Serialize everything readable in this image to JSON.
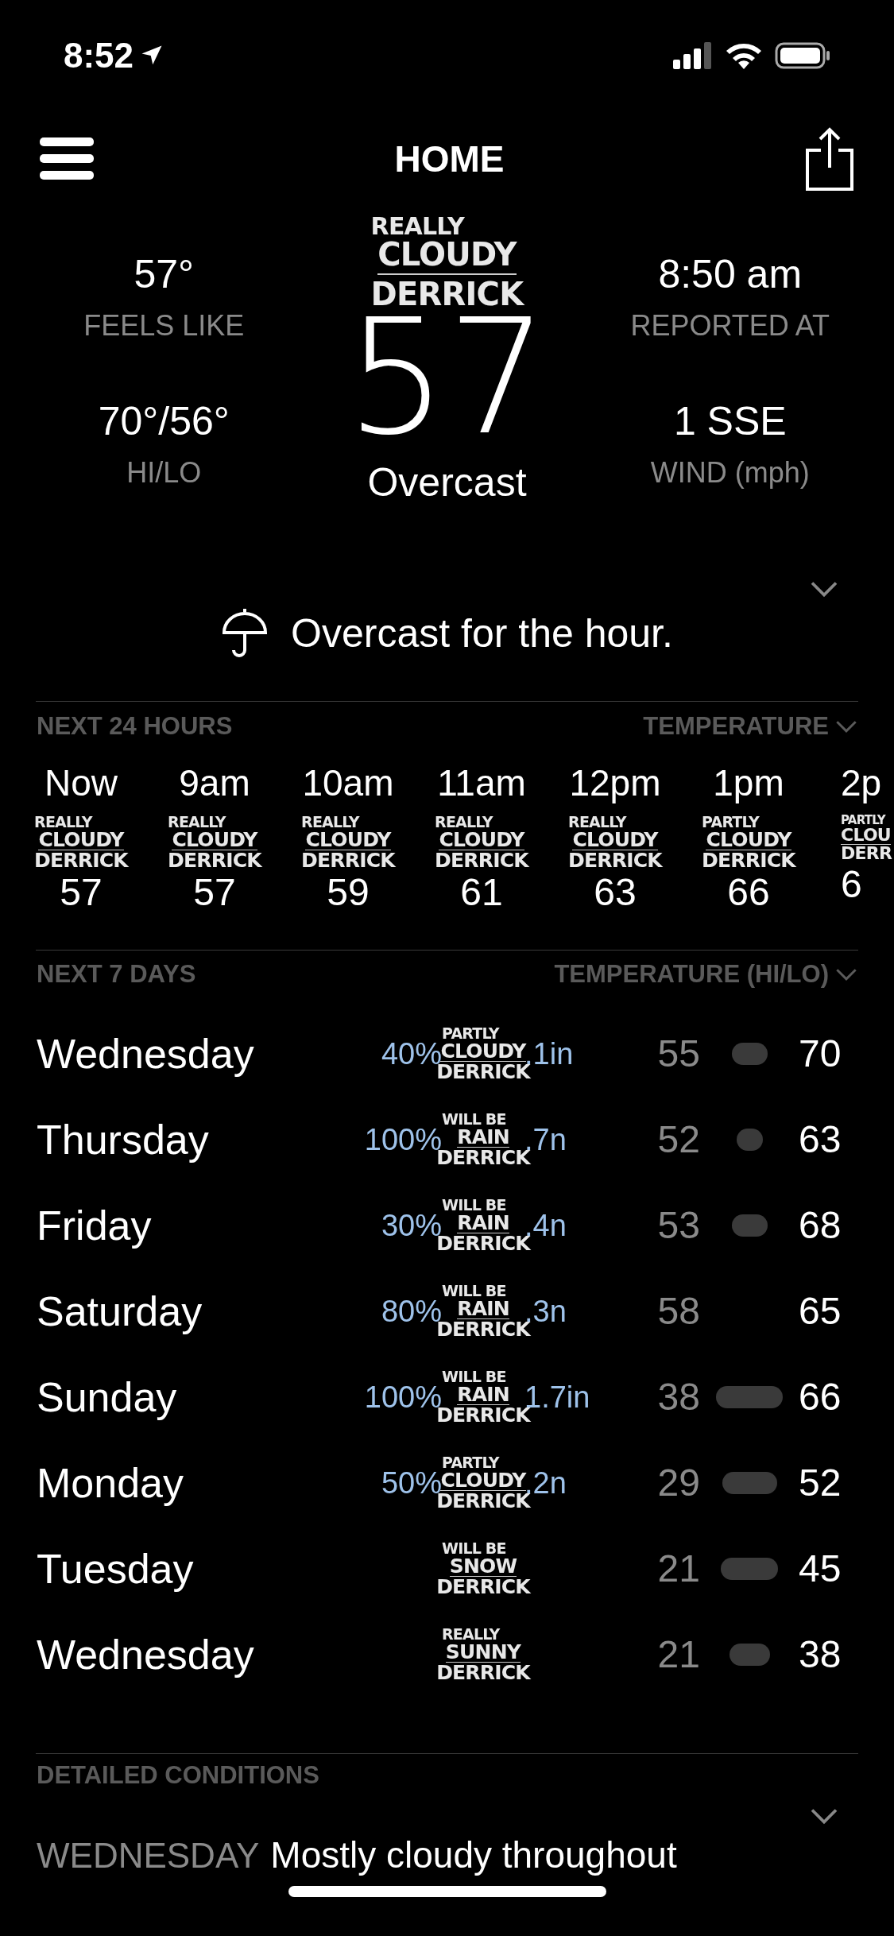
{
  "status_bar": {
    "time": "8:52"
  },
  "header": {
    "title": "HOME"
  },
  "current": {
    "logo": [
      "REALLY",
      "CLOUDY",
      "DERRICK"
    ],
    "temperature": "57",
    "condition": "Overcast",
    "metrics": [
      {
        "value": "57°",
        "label": "FEELS LIKE"
      },
      {
        "value": "8:50 am",
        "label": "REPORTED AT"
      },
      {
        "value": "70°/56°",
        "label": "HI/LO"
      },
      {
        "value": "1 SSE",
        "label": "WIND (mph)"
      }
    ]
  },
  "summary": {
    "text": "Overcast for the hour."
  },
  "hourly": {
    "title": "NEXT 24 HOURS",
    "selector": "TEMPERATURE",
    "hours": [
      {
        "time": "Now",
        "logo": [
          "REALLY",
          "CLOUDY",
          "DERRICK"
        ],
        "temp": "57"
      },
      {
        "time": "9am",
        "logo": [
          "REALLY",
          "CLOUDY",
          "DERRICK"
        ],
        "temp": "57"
      },
      {
        "time": "10am",
        "logo": [
          "REALLY",
          "CLOUDY",
          "DERRICK"
        ],
        "temp": "59"
      },
      {
        "time": "11am",
        "logo": [
          "REALLY",
          "CLOUDY",
          "DERRICK"
        ],
        "temp": "61"
      },
      {
        "time": "12pm",
        "logo": [
          "REALLY",
          "CLOUDY",
          "DERRICK"
        ],
        "temp": "63"
      },
      {
        "time": "1pm",
        "logo": [
          "PARTLY",
          "CLOUDY",
          "DERRICK"
        ],
        "temp": "66"
      },
      {
        "time": "2p",
        "logo": [
          "PARTLY",
          "CLOU",
          "DERR"
        ],
        "temp": "6"
      }
    ]
  },
  "daily": {
    "title": "NEXT 7 DAYS",
    "selector": "TEMPERATURE (HI/LO)",
    "days": [
      {
        "day": "Wednesday",
        "chance": "40%",
        "logo": [
          "PARTLY",
          "CLOUDY",
          "DERRICK"
        ],
        "amount": ".1in",
        "low": "55",
        "high": "70",
        "kind": "bar"
      },
      {
        "day": "Thursday",
        "chance": "100%",
        "logo": [
          "WILL BE",
          "RAIN",
          "DERRICK"
        ],
        "amount": ".7n",
        "low": "52",
        "high": "63",
        "kind": "bar"
      },
      {
        "day": "Friday",
        "chance": "30%",
        "logo": [
          "WILL BE",
          "RAIN",
          "DERRICK"
        ],
        "amount": ".4n",
        "low": "53",
        "high": "68",
        "kind": "bar"
      },
      {
        "day": "Saturday",
        "chance": "80%",
        "logo": [
          "WILL BE",
          "RAIN",
          "DERRICK"
        ],
        "amount": ".3n",
        "low": "58",
        "high": "65",
        "kind": "plain"
      },
      {
        "day": "Sunday",
        "chance": "100%",
        "logo": [
          "WILL BE",
          "RAIN",
          "DERRICK"
        ],
        "amount": "1.7in",
        "low": "38",
        "high": "66",
        "kind": "bar"
      },
      {
        "day": "Monday",
        "chance": "50%",
        "logo": [
          "PARTLY",
          "CLOUDY",
          "DERRICK"
        ],
        "amount": ".2n",
        "low": "29",
        "high": "52",
        "kind": "bar"
      },
      {
        "day": "Tuesday",
        "logo": [
          "WILL BE",
          "SNOW",
          "DERRICK"
        ],
        "low": "21",
        "high": "45",
        "kind": "bar"
      },
      {
        "day": "Wednesday",
        "logo": [
          "REALLY",
          "SUNNY",
          "DERRICK"
        ],
        "low": "21",
        "high": "38",
        "kind": "bar"
      }
    ]
  },
  "detailed": {
    "title": "DETAILED CONDITIONS",
    "day": "WEDNESDAY",
    "text": "Mostly cloudy throughout"
  }
}
